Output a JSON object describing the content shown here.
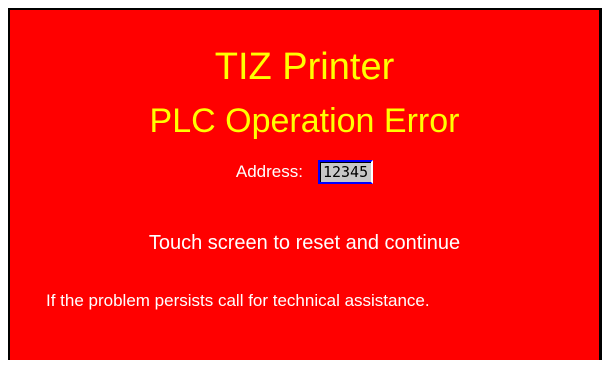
{
  "screen": {
    "title": "TIZ Printer",
    "subtitle": "PLC Operation Error",
    "address_label": "Address:",
    "address_value": "12345",
    "reset_message": "Touch screen to reset and continue",
    "assist_message": "If the problem persists call for technical assistance.",
    "colors": {
      "background": "#ff0000",
      "title_text": "#ffff00",
      "body_text": "#ffffff",
      "field_background": "#c8c8c8",
      "field_border": "#0000ff"
    }
  }
}
